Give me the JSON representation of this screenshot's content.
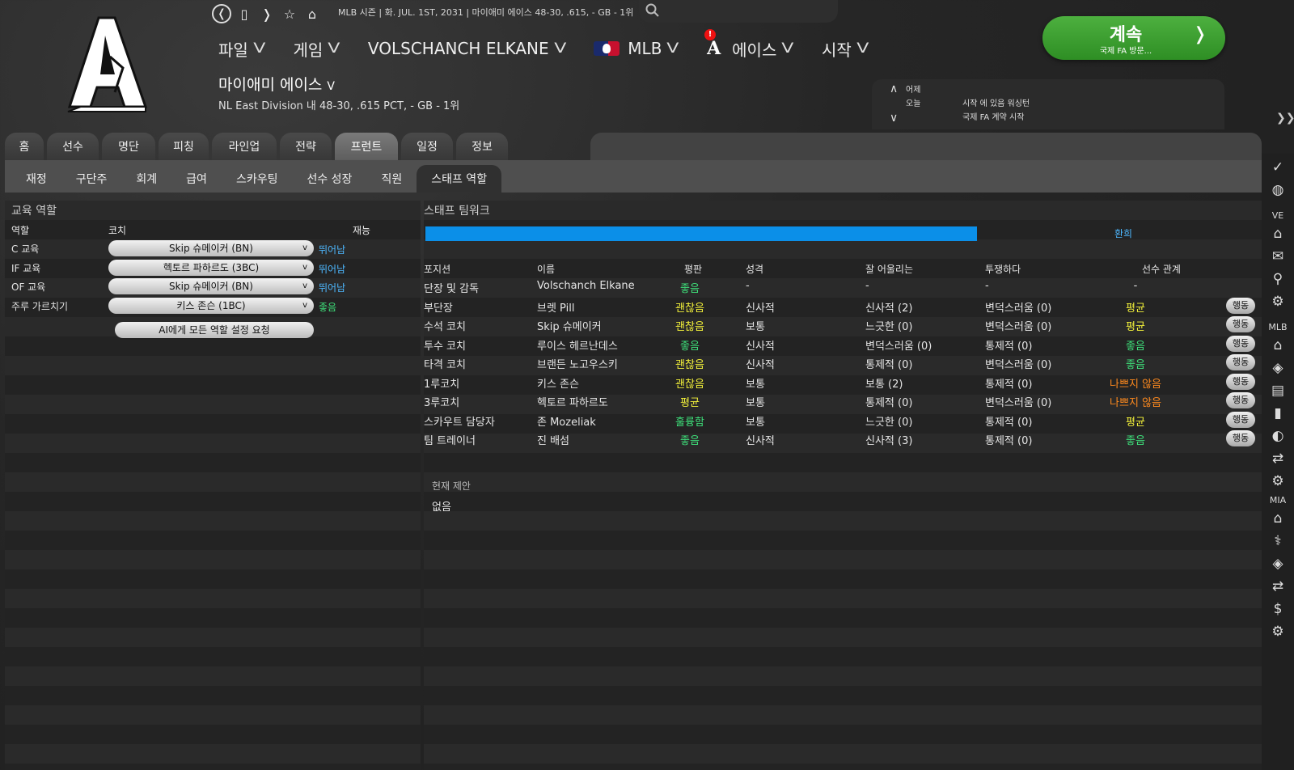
{
  "topbar": {
    "status": "MLB 시즌  |  화. JUL. 1ST, 2031  |  마이애미 에이스  48-30, .615, - GB - 1위",
    "nav_back": "❬",
    "nav_page": "▯",
    "nav_forward": "❭",
    "nav_star": "☆",
    "nav_home": "⌂"
  },
  "menu": {
    "file": "파일",
    "game": "게임",
    "manager": "VOLSCHANCH ELKANE",
    "league": "MLB",
    "league_notification": "!",
    "team": "에이스",
    "start": "시작",
    "team_logo_letter": "A",
    "chevron": "V"
  },
  "team": {
    "name": "마이애미 에이스",
    "record": "NL East Division 내 48-30, .615 PCT, - GB - 1위"
  },
  "continue_button": {
    "label": "계속",
    "sub": "국제 FA 방문...",
    "arrow": "❭"
  },
  "news": {
    "up": "∧",
    "down": "∨",
    "yesterday": "어제",
    "today": "오늘",
    "items": [
      "시작 에 있음 워싱턴",
      "국제 FA 계약 시작"
    ]
  },
  "collapse_label": "❯❯",
  "tabs": [
    "홈",
    "선수",
    "명단",
    "피칭",
    "라인업",
    "전략",
    "프런트",
    "일정",
    "정보"
  ],
  "subtabs": [
    "재정",
    "구단주",
    "회계",
    "급여",
    "스카우팅",
    "선수 성장",
    "직원",
    "스태프 역할"
  ],
  "left_panel": {
    "title": "교육 역할",
    "col_role": "역할",
    "col_coach": "코치",
    "col_talent": "재능",
    "rows": [
      {
        "role": "C 교육",
        "coach": "Skip 슈메이커 (BN)",
        "talent": "뛰어남",
        "talent_color": "#4db8ff"
      },
      {
        "role": "IF 교육",
        "coach": "헥토르 파하르도 (3BC)",
        "talent": "뛰어남",
        "talent_color": "#4db8ff"
      },
      {
        "role": "OF 교육",
        "coach": "Skip 슈메이커 (BN)",
        "talent": "뛰어남",
        "talent_color": "#4db8ff"
      },
      {
        "role": "주루 가르치기",
        "coach": "키스 존슨 (1BC)",
        "talent": "좋음",
        "talent_color": "#3ee07a"
      }
    ],
    "dropdown_chevron": "v",
    "ai_button": "AI에게 모든 역할 설정 요청"
  },
  "right_panel": {
    "title": "스태프 팀워크",
    "teamwork_label": "환희",
    "teamwork_fraction": 0.66,
    "headers": {
      "position": "포지션",
      "name": "이름",
      "reputation": "평판",
      "personality": "성격",
      "fits_with": "잘 어울리는",
      "conflicts": "투쟁하다",
      "player_relation": "선수 관계"
    },
    "action_label": "행동",
    "rows": [
      {
        "position": "단장 및 감독",
        "name": "Volschanch Elkane",
        "reputation": "좋음",
        "rep_color": "#3ee07a",
        "personality": "-",
        "fits": "-",
        "conflicts": "-",
        "relation": "-",
        "rel_color": "#e6e6e6",
        "has_action": false
      },
      {
        "position": "부단장",
        "name": "브렛 Pill",
        "reputation": "괜찮음",
        "rep_color": "#f2f03a",
        "personality": "신사적",
        "fits": "신사적 (2)",
        "conflicts": "변덕스러움 (0)",
        "relation": "평균",
        "rel_color": "#f2f03a",
        "has_action": true
      },
      {
        "position": "수석 코치",
        "name": "Skip 슈메이커",
        "reputation": "괜찮음",
        "rep_color": "#f2f03a",
        "personality": "보통",
        "fits": "느긋한 (0)",
        "conflicts": "변덕스러움 (0)",
        "relation": "평균",
        "rel_color": "#f2f03a",
        "has_action": true
      },
      {
        "position": "투수 코치",
        "name": "루이스 헤르난데스",
        "reputation": "좋음",
        "rep_color": "#3ee07a",
        "personality": "신사적",
        "fits": "변덕스러움 (0)",
        "conflicts": "통제적 (0)",
        "relation": "좋음",
        "rel_color": "#3ee07a",
        "has_action": true
      },
      {
        "position": "타격 코치",
        "name": "브랜든 노고우스키",
        "reputation": "괜찮음",
        "rep_color": "#f2f03a",
        "personality": "신사적",
        "fits": "통제적 (0)",
        "conflicts": "변덕스러움 (0)",
        "relation": "좋음",
        "rel_color": "#3ee07a",
        "has_action": true
      },
      {
        "position": "1루코치",
        "name": "키스 존슨",
        "reputation": "괜찮음",
        "rep_color": "#f2f03a",
        "personality": "보통",
        "fits": "보통 (2)",
        "conflicts": "통제적 (0)",
        "relation": "나쁘지 않음",
        "rel_color": "#ff8a1e",
        "has_action": true
      },
      {
        "position": "3루코치",
        "name": "헥토르 파하르도",
        "reputation": "평균",
        "rep_color": "#f2f03a",
        "personality": "보통",
        "fits": "통제적 (0)",
        "conflicts": "변덕스러움 (0)",
        "relation": "나쁘지 않음",
        "rel_color": "#ff8a1e",
        "has_action": true
      },
      {
        "position": "스카우트 담당자",
        "name": "존 Mozeliak",
        "reputation": "훌륭함",
        "rep_color": "#3ee07a",
        "personality": "보통",
        "fits": "느긋한 (0)",
        "conflicts": "통제적 (0)",
        "relation": "평균",
        "rel_color": "#f2f03a",
        "has_action": true
      },
      {
        "position": "팀 트레이너",
        "name": "진 배섬",
        "reputation": "좋음",
        "rep_color": "#3ee07a",
        "personality": "신사적",
        "fits": "신사적 (3)",
        "conflicts": "통제적 (0)",
        "relation": "좋음",
        "rel_color": "#3ee07a",
        "has_action": true
      }
    ],
    "current_offer_label": "현재 제안",
    "current_offer_value": "없음"
  },
  "sidebar": {
    "labels": {
      "ve": "VE",
      "mlb": "MLB",
      "mia": "MIA"
    }
  },
  "colors": {
    "accent_green": "#3aa12e",
    "teamwork_bar": "#0b8fe8"
  }
}
